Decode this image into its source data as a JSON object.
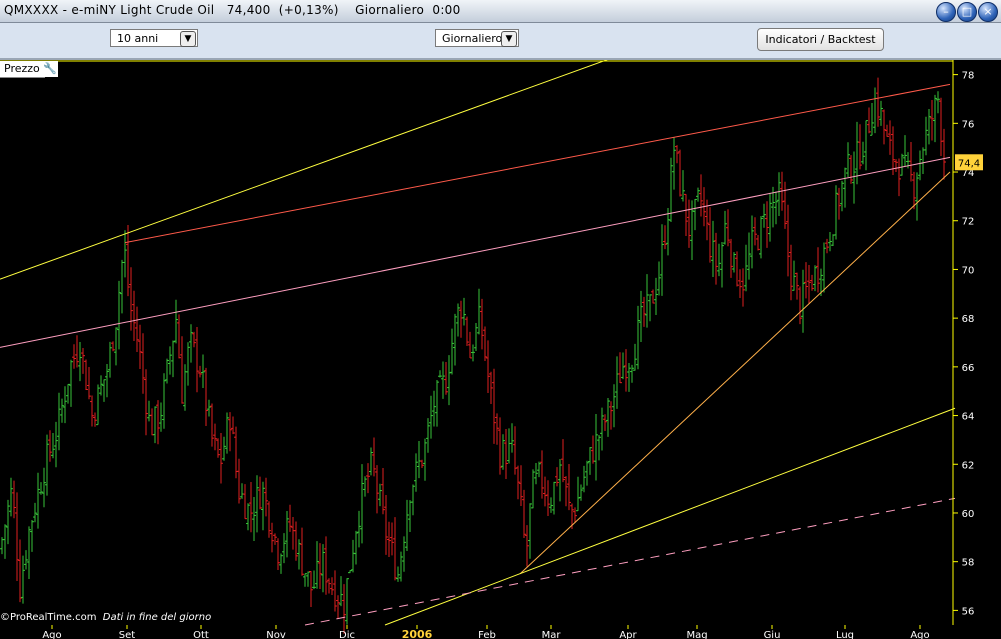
{
  "window": {
    "title": "QMXXXX - e-miNY Light Crude Oil   74,400  (+0,13%)    Giornaliero  0:00"
  },
  "toolbar": {
    "range_select": "10 anni",
    "period_select": "Giornaliero",
    "indicators_button": "Indicatori / Backtest"
  },
  "panel": {
    "price_label": "Prezzo",
    "credits": "ProRealTime.com",
    "credits_note": "Dati in fine del giorno"
  },
  "colors": {
    "background": "#000000",
    "up_bar": "#39c53a",
    "down_bar": "#e02020",
    "axis_line": "#ffff00",
    "trend_red": "#ff5a4a",
    "trend_pink": "#ff9fc0",
    "trend_yellow": "#ffff40",
    "support_orange": "#ffb04a"
  },
  "chart_data": {
    "type": "bar",
    "title": "",
    "last_price": "74,4",
    "ylim": [
      55.4,
      78.6
    ],
    "y_ticks": [
      56,
      58,
      60,
      62,
      64,
      66,
      68,
      70,
      72,
      74,
      76,
      78
    ],
    "x_labels": [
      {
        "label": "Ago",
        "t": 52
      },
      {
        "label": "Set",
        "t": 127
      },
      {
        "label": "Ott",
        "t": 201
      },
      {
        "label": "Nov",
        "t": 276
      },
      {
        "label": "Dic",
        "t": 347
      },
      {
        "label": "2006",
        "t": 417
      },
      {
        "label": "Feb",
        "t": 487
      },
      {
        "label": "Mar",
        "t": 551
      },
      {
        "label": "Apr",
        "t": 628
      },
      {
        "label": "Mag",
        "t": 697
      },
      {
        "label": "Giu",
        "t": 772
      },
      {
        "label": "Lug",
        "t": 845
      },
      {
        "label": "Ago",
        "t": 920
      }
    ],
    "anchors": [
      [
        0,
        58.5
      ],
      [
        12,
        61
      ],
      [
        20,
        57
      ],
      [
        30,
        59.5
      ],
      [
        45,
        62
      ],
      [
        58,
        63.5
      ],
      [
        70,
        66
      ],
      [
        80,
        67
      ],
      [
        92,
        64
      ],
      [
        108,
        66
      ],
      [
        116,
        68
      ],
      [
        124,
        71
      ],
      [
        130,
        68.5
      ],
      [
        138,
        67
      ],
      [
        150,
        63.5
      ],
      [
        160,
        64
      ],
      [
        168,
        66
      ],
      [
        176,
        68
      ],
      [
        182,
        65
      ],
      [
        190,
        67
      ],
      [
        200,
        66
      ],
      [
        212,
        63
      ],
      [
        220,
        62
      ],
      [
        230,
        64
      ],
      [
        238,
        61
      ],
      [
        250,
        60
      ],
      [
        262,
        61
      ],
      [
        278,
        58.5
      ],
      [
        290,
        59.5
      ],
      [
        302,
        58
      ],
      [
        312,
        56.8
      ],
      [
        322,
        58
      ],
      [
        332,
        57
      ],
      [
        344,
        56.3
      ],
      [
        356,
        59.5
      ],
      [
        364,
        61
      ],
      [
        372,
        62
      ],
      [
        384,
        59.5
      ],
      [
        398,
        57.5
      ],
      [
        410,
        61
      ],
      [
        424,
        62.5
      ],
      [
        434,
        64.5
      ],
      [
        446,
        65.5
      ],
      [
        456,
        68
      ],
      [
        462,
        68.6
      ],
      [
        470,
        66.5
      ],
      [
        480,
        68
      ],
      [
        490,
        65
      ],
      [
        500,
        62.5
      ],
      [
        512,
        62.5
      ],
      [
        520,
        60.5
      ],
      [
        526,
        58.2
      ],
      [
        532,
        61
      ],
      [
        540,
        61.5
      ],
      [
        550,
        60.5
      ],
      [
        560,
        62
      ],
      [
        570,
        60
      ],
      [
        576,
        60.3
      ],
      [
        584,
        61.5
      ],
      [
        592,
        62.5
      ],
      [
        602,
        63.5
      ],
      [
        612,
        64.5
      ],
      [
        622,
        66
      ],
      [
        632,
        66.5
      ],
      [
        642,
        68
      ],
      [
        650,
        68.5
      ],
      [
        660,
        70
      ],
      [
        668,
        72.5
      ],
      [
        674,
        75
      ],
      [
        682,
        73
      ],
      [
        690,
        71.5
      ],
      [
        700,
        73
      ],
      [
        710,
        71
      ],
      [
        718,
        70
      ],
      [
        726,
        72
      ],
      [
        734,
        70
      ],
      [
        744,
        69.5
      ],
      [
        752,
        71
      ],
      [
        760,
        71.5
      ],
      [
        770,
        72.5
      ],
      [
        780,
        73
      ],
      [
        790,
        70
      ],
      [
        800,
        68.5
      ],
      [
        810,
        69.5
      ],
      [
        818,
        70
      ],
      [
        826,
        71
      ],
      [
        836,
        72.5
      ],
      [
        846,
        74
      ],
      [
        856,
        74.5
      ],
      [
        866,
        75.5
      ],
      [
        874,
        77
      ],
      [
        880,
        76.5
      ],
      [
        888,
        75
      ],
      [
        896,
        74.5
      ],
      [
        906,
        74
      ],
      [
        914,
        73.5
      ],
      [
        922,
        75
      ],
      [
        930,
        76
      ],
      [
        938,
        77
      ],
      [
        944,
        74.6
      ]
    ],
    "lines": [
      {
        "name": "top-yellow",
        "from": [
          0,
          69.6
        ],
        "to": [
          613,
          78.7
        ]
      },
      {
        "name": "red-resistance",
        "from": [
          125,
          71.1
        ],
        "to": [
          950,
          77.6
        ]
      },
      {
        "name": "pink-trend",
        "from": [
          0,
          66.8
        ],
        "to": [
          950,
          74.6
        ]
      },
      {
        "name": "orange-support",
        "from": [
          520,
          57.5
        ],
        "to": [
          950,
          74
        ]
      },
      {
        "name": "yellow-support",
        "from": [
          385,
          55.4
        ],
        "to": [
          955,
          64.3
        ]
      },
      {
        "name": "pink-dashed",
        "from": [
          305,
          55.4
        ],
        "to": [
          955,
          60.6
        ]
      }
    ]
  }
}
